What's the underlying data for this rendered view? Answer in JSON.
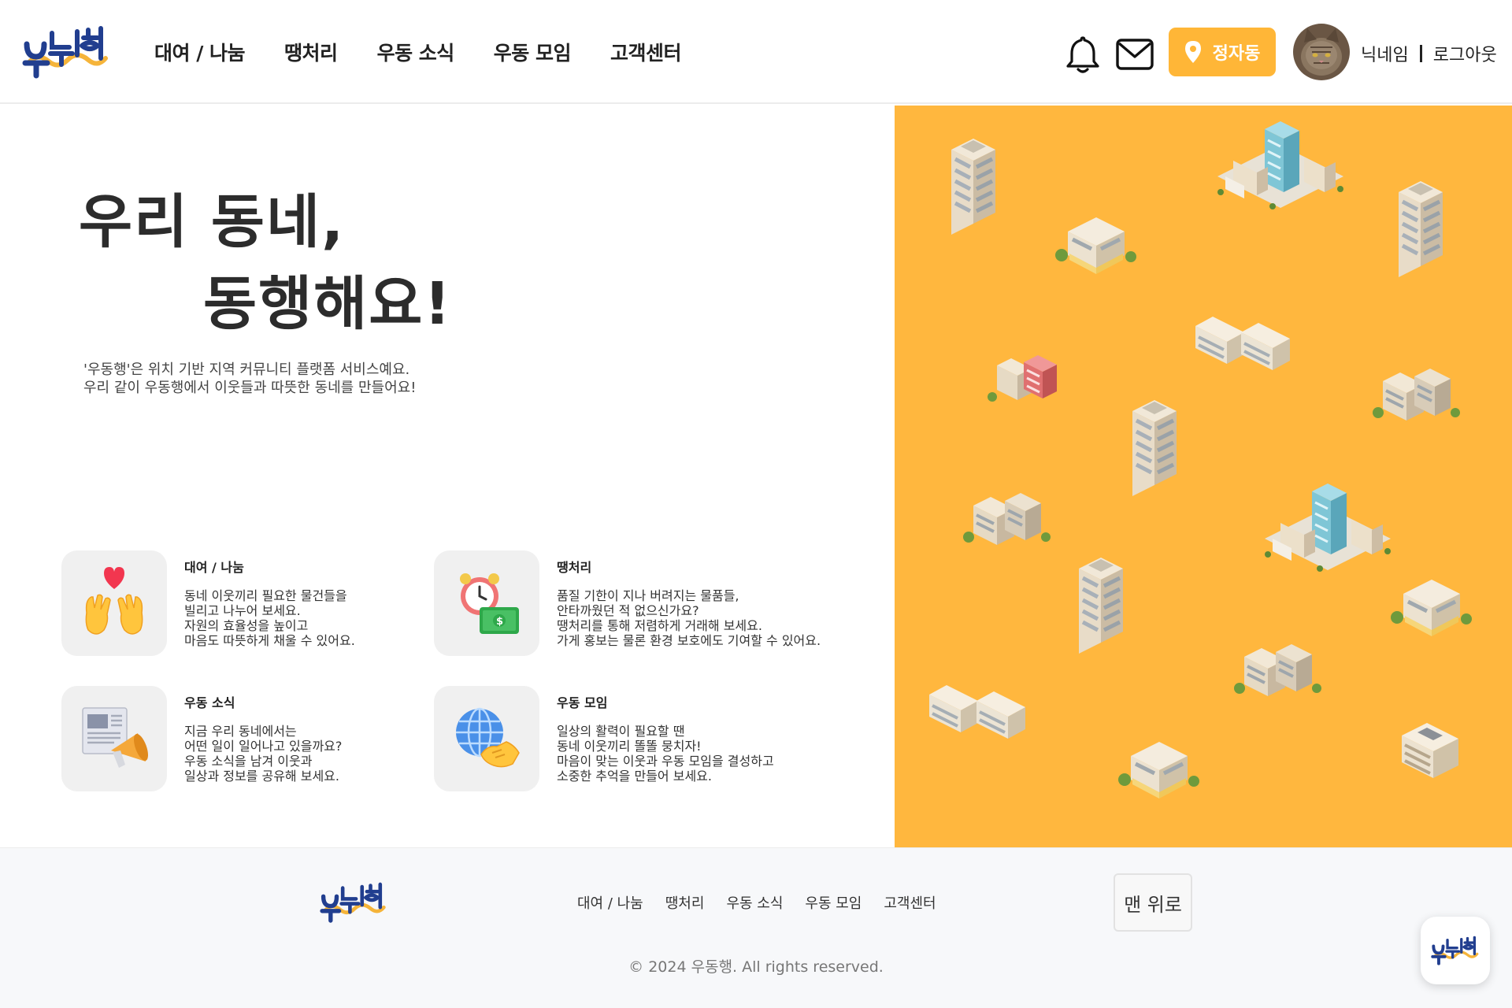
{
  "brand": {
    "name": "우동행",
    "colors": {
      "accent": "#ffb637",
      "logo_blue": "#213e8f",
      "logo_yellow": "#f5b43a",
      "panel": "#ffb73e"
    }
  },
  "header": {
    "nav": [
      "대여 / 나눔",
      "땡처리",
      "우동 소식",
      "우동 모임",
      "고객센터"
    ],
    "icons": {
      "notification": "bell-icon",
      "message": "mail-icon"
    },
    "location_label": "정자동",
    "user": {
      "nickname": "닉네임",
      "logout": "로그아웃"
    }
  },
  "hero": {
    "title_line1": "우리 동네,",
    "title_line2": "동행해요!",
    "desc_line1": "'우동행'은 위치 기반 지역 커뮤니티 플랫폼 서비스예요.",
    "desc_line2": "우리 같이 우동행에서 이웃들과 따뜻한 동네를 만들어요!"
  },
  "features": [
    {
      "title": "대여 / 나눔",
      "icon": "heart-hands-icon",
      "desc": "동네 이웃끼리 필요한 물건들을\n빌리고 나누어 보세요.\n자원의 효율성을 높이고\n마음도 따뜻하게 채울 수 있어요."
    },
    {
      "title": "땡처리",
      "icon": "alarm-money-icon",
      "desc": "품질 기한이 지나 버려지는 물품들,\n안타까웠던 적 없으신가요?\n땡처리를 통해 저렴하게 거래해 보세요.\n가게 홍보는 물론 환경 보호에도 기여할 수 있어요."
    },
    {
      "title": "우동 소식",
      "icon": "news-megaphone-icon",
      "desc": "지금 우리 동네에서는\n어떤 일이 일어나고 있을까요?\n우동 소식을 남겨 이웃과\n일상과 정보를 공유해 보세요."
    },
    {
      "title": "우동 모임",
      "icon": "globe-handshake-icon",
      "desc": "일상의 활력이 필요할 땐\n동네 이웃끼리 똘똘 뭉치자!\n마음이 맞는 이웃과 우동 모임을 결성하고\n소중한 추억을 만들어 보세요."
    }
  ],
  "footer": {
    "nav": [
      "대여 / 나눔",
      "땡처리",
      "우동 소식",
      "우동 모임",
      "고객센터"
    ],
    "top_button": "맨 위로",
    "copyright": "© 2024 우동행. All rights reserved."
  }
}
